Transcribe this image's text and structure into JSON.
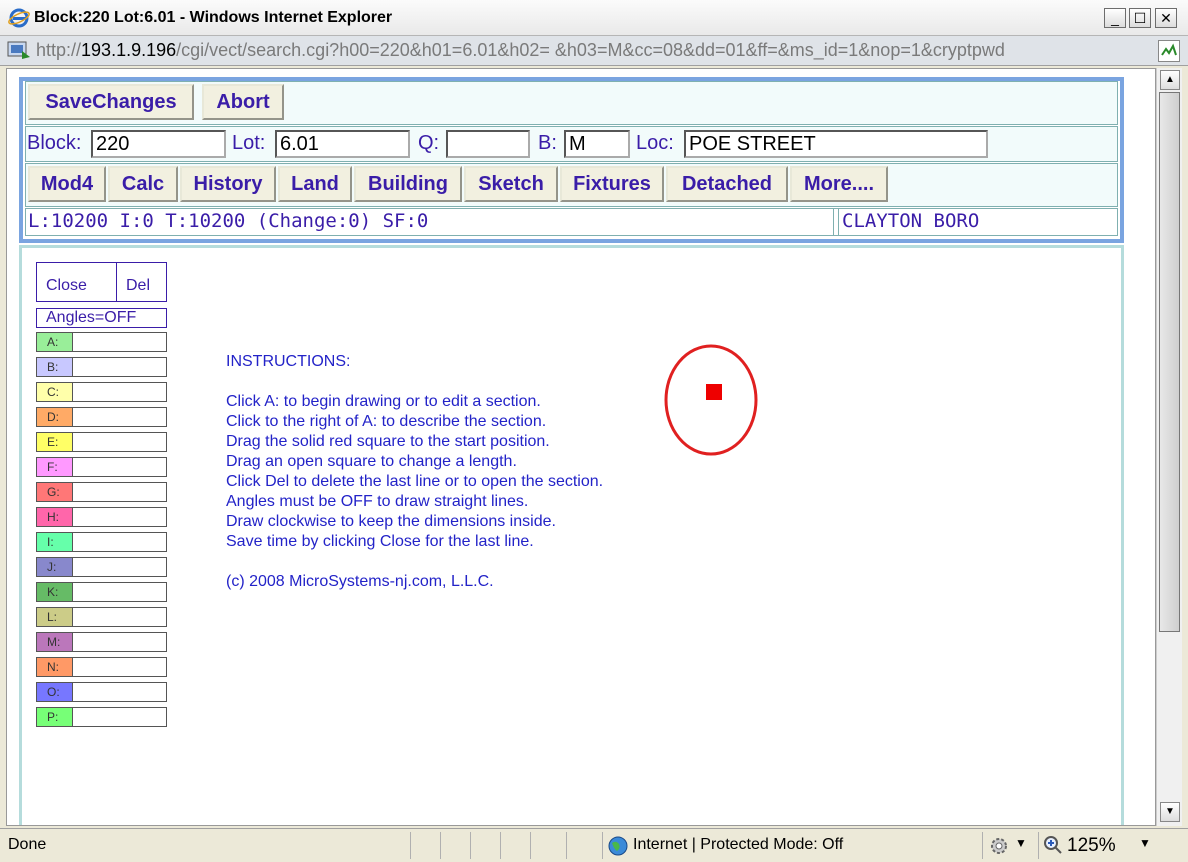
{
  "window": {
    "title": "Block:220 Lot:6.01 - Windows Internet Explorer",
    "min": "_",
    "max": "☐",
    "close": "✕"
  },
  "address": {
    "scheme": "http://",
    "host": "193.1.9.196",
    "path": "/cgi/vect/search.cgi?h00=220&h01=6.01&h02= &h03=M&cc=08&dd=01&ff=&ms_id=1&nop=1&cryptpwd"
  },
  "toolbar": {
    "save": "SaveChanges",
    "abort": "Abort"
  },
  "fields": {
    "block_label": "Block:",
    "block_value": "220",
    "lot_label": "Lot:",
    "lot_value": "6.01",
    "q_label": "Q:",
    "q_value": "",
    "b_label": "B:",
    "b_value": "M",
    "loc_label": "Loc:",
    "loc_value": "POE STREET"
  },
  "nav": [
    "Mod4",
    "Calc",
    "History",
    "Land",
    "Building",
    "Sketch",
    "Fixtures",
    "Detached",
    "More...."
  ],
  "summary": {
    "values": "L:10200 I:0 T:10200 (Change:0) SF:0",
    "municipality": "CLAYTON BORO"
  },
  "sketch": {
    "close": "Close",
    "del": "Del",
    "angles": "Angles=OFF",
    "sections": [
      {
        "key": "A:",
        "color": "#99ee99"
      },
      {
        "key": "B:",
        "color": "#c8c8ff"
      },
      {
        "key": "C:",
        "color": "#ffffaa"
      },
      {
        "key": "D:",
        "color": "#ffaa66"
      },
      {
        "key": "E:",
        "color": "#ffff66"
      },
      {
        "key": "F:",
        "color": "#ff99ff"
      },
      {
        "key": "G:",
        "color": "#ff7777"
      },
      {
        "key": "H:",
        "color": "#ff66aa"
      },
      {
        "key": "I:",
        "color": "#66ffaa"
      },
      {
        "key": "J:",
        "color": "#8888cc"
      },
      {
        "key": "K:",
        "color": "#66bb66"
      },
      {
        "key": "L:",
        "color": "#cccc88"
      },
      {
        "key": "M:",
        "color": "#bb77bb"
      },
      {
        "key": "N:",
        "color": "#ff9966"
      },
      {
        "key": "O:",
        "color": "#7777ff"
      },
      {
        "key": "P:",
        "color": "#77ff77"
      }
    ],
    "instructions": "INSTRUCTIONS:\n\nClick A: to begin drawing or to edit a section.\nClick to the right of A: to describe the section.\nDrag the solid red square to the start position.\nDrag an open square to change a length.\nClick Del to delete the last line or to open the section.\nAngles must be OFF to draw straight lines.\nDraw clockwise to keep the dimensions inside.\nSave time by clicking Close for the last line.\n\n(c) 2008 MicroSystems-nj.com, L.L.C."
  },
  "status": {
    "left": "Done",
    "zone": "Internet | Protected Mode: Off",
    "zoom": "125%"
  }
}
